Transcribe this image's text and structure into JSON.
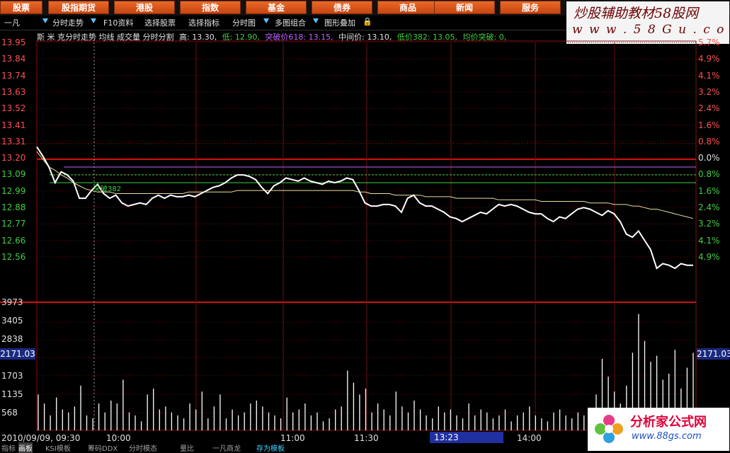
{
  "top_menu": [
    {
      "label": "股票",
      "active": true
    },
    {
      "label": "股指期货"
    },
    {
      "label": "港股"
    },
    {
      "label": "指数"
    },
    {
      "label": "基金"
    },
    {
      "label": "债券"
    },
    {
      "label": "商品"
    },
    {
      "label": "新闻"
    },
    {
      "label": "服务"
    }
  ],
  "brand": {
    "title": "炒股辅助教材58股网",
    "url": "w w w . 5 8 G u . c o m"
  },
  "toolbar": {
    "stock_name": "一凡",
    "items": [
      "分时走势",
      "F10资料",
      "选择股票",
      "选择指标",
      "分时图",
      "多图组合",
      "图形叠加"
    ]
  },
  "infobar": {
    "line1": "斯 米 克分时走势 均线 成交量 分时分割",
    "high_label": "高:",
    "high": "13.30,",
    "low_label": "低:",
    "low": "12.90,",
    "break_label": "突破价618:",
    "break": "13.15,",
    "mid_label": "中间价:",
    "mid": "13.10,",
    "lowp_label": "低价382:",
    "lowp": "13.05,",
    "avg_label": "均价突破:",
    "avg": "0,"
  },
  "price_axis_left": [
    "13.95",
    "13.84",
    "13.74",
    "13.63",
    "13.52",
    "13.41",
    "13.31",
    "13.20",
    "13.09",
    "12.99",
    "12.88",
    "12.77",
    "12.66",
    "12.56"
  ],
  "pct_axis_right": [
    "5.7%",
    "4.9%",
    "4.1%",
    "3.2%",
    "2.4%",
    "1.6%",
    "0.8%",
    "0.0%",
    "0.8%",
    "1.6%",
    "2.4%",
    "3.2%",
    "4.1%",
    "4.9%"
  ],
  "volume_axis": [
    "3973",
    "3405",
    "2838",
    "2171.03",
    "1703",
    "1135",
    "568"
  ],
  "volume_badge_right": "2171.03",
  "chart_annotation": "突破382",
  "time_axis": [
    "2010/09/09, 09:30",
    "10:00",
    "11:00",
    "11:30",
    "13:23",
    "14:00"
  ],
  "bottom_tabs": [
    "指标",
    "画板",
    "KSI模板",
    "筹码DDX",
    "分时模态",
    "量比",
    "一凡商龙",
    "存为模板"
  ],
  "watermark": {
    "title": "分析家公式网",
    "url": "www.88gs.com"
  },
  "chart_data": {
    "type": "line",
    "title": "",
    "xlabel": "",
    "ylabel": "",
    "ylim": [
      12.5,
      13.98
    ],
    "previous_close": 13.2,
    "price_series": [
      13.28,
      13.22,
      13.15,
      13.05,
      13.12,
      13.1,
      13.06,
      12.95,
      12.95,
      13.0,
      13.04,
      12.98,
      12.95,
      12.97,
      12.92,
      12.9,
      12.91,
      12.92,
      12.91,
      12.95,
      12.97,
      12.95,
      12.97,
      12.96,
      12.96,
      12.97,
      12.96,
      12.98,
      13.0,
      13.02,
      13.03,
      13.05,
      13.08,
      13.1,
      13.1,
      13.09,
      13.07,
      13.02,
      12.98,
      13.03,
      13.05,
      13.08,
      13.07,
      13.06,
      13.08,
      13.06,
      13.05,
      13.04,
      13.06,
      13.05,
      13.06,
      13.08,
      13.07,
      13.0,
      12.92,
      12.9,
      12.9,
      12.91,
      12.91,
      12.9,
      12.86,
      12.95,
      12.97,
      12.92,
      12.9,
      12.9,
      12.88,
      12.86,
      12.83,
      12.82,
      12.8,
      12.82,
      12.84,
      12.86,
      12.85,
      12.88,
      12.91,
      12.9,
      12.91,
      12.9,
      12.88,
      12.86,
      12.85,
      12.85,
      12.82,
      12.8,
      12.83,
      12.82,
      12.85,
      12.88,
      12.89,
      12.88,
      12.86,
      12.84,
      12.87,
      12.85,
      12.8,
      12.72,
      12.7,
      12.74,
      12.68,
      12.62,
      12.5,
      12.53,
      12.52,
      12.5,
      12.53,
      12.52,
      12.52
    ],
    "avg_series": [
      13.25,
      13.2,
      13.15,
      13.13,
      13.1,
      13.08,
      13.05,
      13.03,
      13.01,
      13.0,
      12.99,
      12.99,
      12.99,
      12.98,
      12.98,
      12.98,
      12.98,
      12.98,
      12.98,
      12.98,
      12.98,
      12.98,
      12.98,
      12.98,
      12.98,
      12.99,
      12.99,
      12.99,
      12.99,
      12.99,
      12.99,
      12.99,
      12.99,
      13.0,
      13.0,
      13.0,
      13.0,
      13.0,
      13.0,
      13.0,
      13.0,
      13.0,
      13.0,
      13.0,
      13.0,
      13.0,
      13.0,
      13.0,
      13.0,
      13.0,
      13.0,
      13.0,
      13.0,
      12.99,
      12.99,
      12.98,
      12.98,
      12.98,
      12.98,
      12.97,
      12.97,
      12.97,
      12.97,
      12.97,
      12.96,
      12.96,
      12.96,
      12.96,
      12.96,
      12.95,
      12.95,
      12.95,
      12.95,
      12.95,
      12.95,
      12.95,
      12.94,
      12.94,
      12.94,
      12.94,
      12.94,
      12.94,
      12.94,
      12.93,
      12.93,
      12.93,
      12.93,
      12.93,
      12.93,
      12.93,
      12.93,
      12.92,
      12.92,
      12.92,
      12.92,
      12.91,
      12.91,
      12.91,
      12.9,
      12.9,
      12.89,
      12.88,
      12.88,
      12.87,
      12.86,
      12.85,
      12.84,
      12.83,
      12.82
    ],
    "reference_lines": [
      {
        "value": 13.15,
        "color": "#c060ff"
      },
      {
        "value": 13.1,
        "color": "#40d040"
      },
      {
        "value": 13.05,
        "color": "#40d040"
      }
    ],
    "volume_max": 4200,
    "volume": [
      1200,
      900,
      500,
      1100,
      700,
      600,
      800,
      1500,
      500,
      400,
      900,
      600,
      1000,
      900,
      1700,
      600,
      500,
      300,
      1200,
      1400,
      700,
      800,
      600,
      500,
      400,
      900,
      700,
      1300,
      400,
      800,
      1200,
      400,
      700,
      500,
      600,
      900,
      1000,
      800,
      600,
      500,
      400,
      1100,
      600,
      700,
      900,
      500,
      600,
      300,
      400,
      700,
      800,
      2000,
      1600,
      1200,
      1400,
      600,
      900,
      700,
      500,
      1300,
      800,
      600,
      1000,
      700,
      500,
      400,
      800,
      600,
      700,
      500,
      400,
      900,
      500,
      700,
      600,
      400,
      500,
      700,
      300,
      500,
      600,
      800,
      500,
      400,
      300,
      600,
      700,
      500,
      400,
      600,
      500,
      700,
      1200,
      2400,
      1800,
      1300,
      900,
      1500,
      2600,
      3900,
      3000,
      2300,
      2500,
      1700,
      1900,
      2700,
      1400,
      2100,
      2600
    ],
    "session_break_index": 59
  }
}
